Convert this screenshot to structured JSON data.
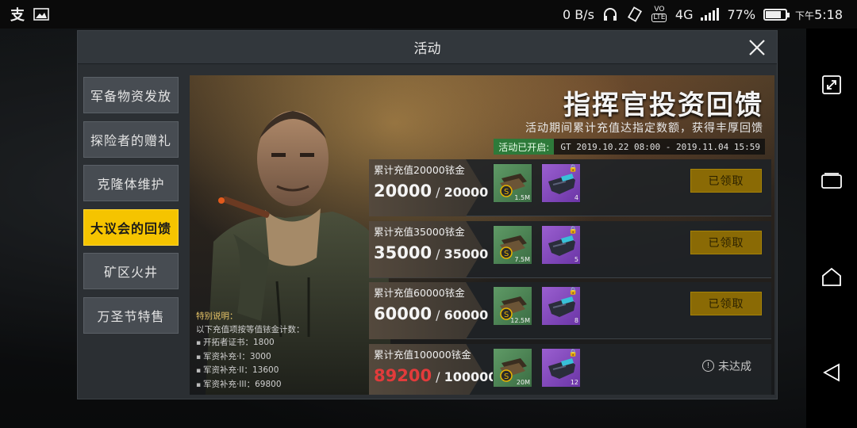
{
  "status_bar": {
    "left_icons": [
      "alipay-icon",
      "image-icon"
    ],
    "app_glyph": "支",
    "net_speed": "0 B/s",
    "lte_label": "LTE",
    "volte_label": "VO",
    "network": "4G",
    "battery_percent": "77%",
    "battery_level": 0.77,
    "time_prefix": "下午",
    "time": "5:18"
  },
  "dialog": {
    "title": "活动",
    "close_icon": "close-icon"
  },
  "tabs": [
    {
      "label": "军备物资发放",
      "active": false
    },
    {
      "label": "探险者的赠礼",
      "active": false
    },
    {
      "label": "克隆体维护",
      "active": false
    },
    {
      "label": "大议会的回馈",
      "active": true
    },
    {
      "label": "矿区火井",
      "active": false
    },
    {
      "label": "万圣节特售",
      "active": false
    }
  ],
  "banner": {
    "title": "指挥官投资回馈",
    "subtitle": "活动期间累计充值达指定数额，获得丰厚回馈",
    "open_label": "活动已开启:",
    "date_range": "GT 2019.10.22 08:00 - 2019.11.04 15:59"
  },
  "notes": {
    "title": "特别说明：",
    "intro": "以下充值项按等值铱金计数：",
    "items": [
      "开拓者证书：1800",
      "军资补充·I：3000",
      "军资补充·II：13600",
      "军资补充·III：69800"
    ]
  },
  "rewards": [
    {
      "requirement": "累计充值20000铱金",
      "current": "20000",
      "sep": " / ",
      "total": "20000",
      "reached": true,
      "item1_qty": "1.5M",
      "item2_qty": "4",
      "status": "已领取"
    },
    {
      "requirement": "累计充值35000铱金",
      "current": "35000",
      "sep": " / ",
      "total": "35000",
      "reached": true,
      "item1_qty": "7.5M",
      "item2_qty": "5",
      "status": "已领取"
    },
    {
      "requirement": "累计充值60000铱金",
      "current": "60000",
      "sep": " / ",
      "total": "60000",
      "reached": true,
      "item1_qty": "12.5M",
      "item2_qty": "8",
      "status": "已领取"
    },
    {
      "requirement": "累计充值100000铱金",
      "current": "89200",
      "sep": " / ",
      "total": "100000",
      "reached": false,
      "item1_qty": "20M",
      "item2_qty": "12",
      "status": "未达成"
    }
  ],
  "colors": {
    "accent_tab": "#f5c400",
    "claimed_button": "#8a6a05",
    "not_reached_value": "#e23b3b",
    "item_green": "#5f9a66",
    "item_purple": "#9a5fd0",
    "open_badge": "#2e7a3a"
  },
  "nav_icons": [
    "rotate-icon",
    "recent-apps-icon",
    "home-icon",
    "back-icon"
  ]
}
